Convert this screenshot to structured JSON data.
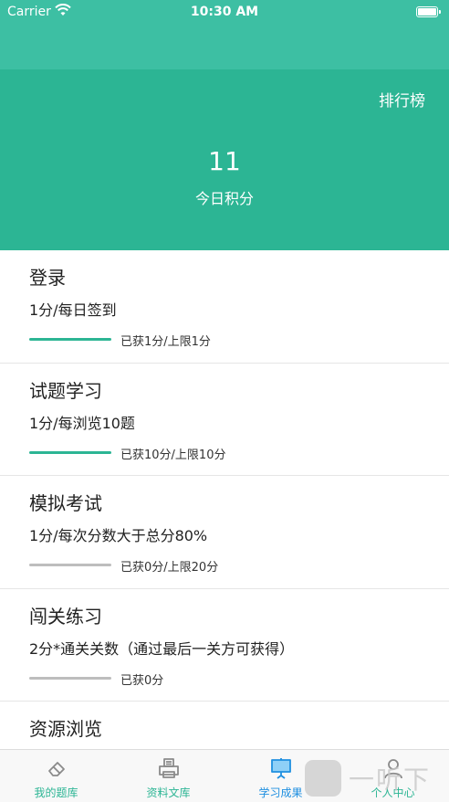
{
  "status_bar": {
    "carrier": "Carrier",
    "time": "10:30 AM"
  },
  "header": {
    "leaderboard_label": "排行榜",
    "points_value": "11",
    "points_label": "今日积分"
  },
  "tasks": [
    {
      "title": "登录",
      "rule": "1分/每日签到",
      "progress_text": "已获1分/上限1分",
      "progress": 1.0
    },
    {
      "title": "试题学习",
      "rule": "1分/每浏览10题",
      "progress_text": "已获10分/上限10分",
      "progress": 1.0
    },
    {
      "title": "模拟考试",
      "rule": "1分/每次分数大于总分80%",
      "progress_text": "已获0分/上限20分",
      "progress": 0.0
    },
    {
      "title": "闯关练习",
      "rule": "2分*通关关数（通过最后一关方可获得）",
      "progress_text": "已获0分",
      "progress": 0.0
    },
    {
      "title": "资源浏览"
    }
  ],
  "tabs": [
    {
      "label": "我的题库",
      "icon": "eraser-icon",
      "active": false
    },
    {
      "label": "资料文库",
      "icon": "printer-icon",
      "active": false
    },
    {
      "label": "学习成果",
      "icon": "easel-icon",
      "active": true
    },
    {
      "label": "个人中心",
      "icon": "person-icon",
      "active": false
    }
  ],
  "colors": {
    "header_bg": "#2cb594",
    "nav_bg": "#3dbfa3",
    "accent": "#2cb594",
    "tab_active": "#1f8fe0",
    "progress_track": "#bdbdbd"
  },
  "watermark": {
    "text": "一听下载"
  }
}
